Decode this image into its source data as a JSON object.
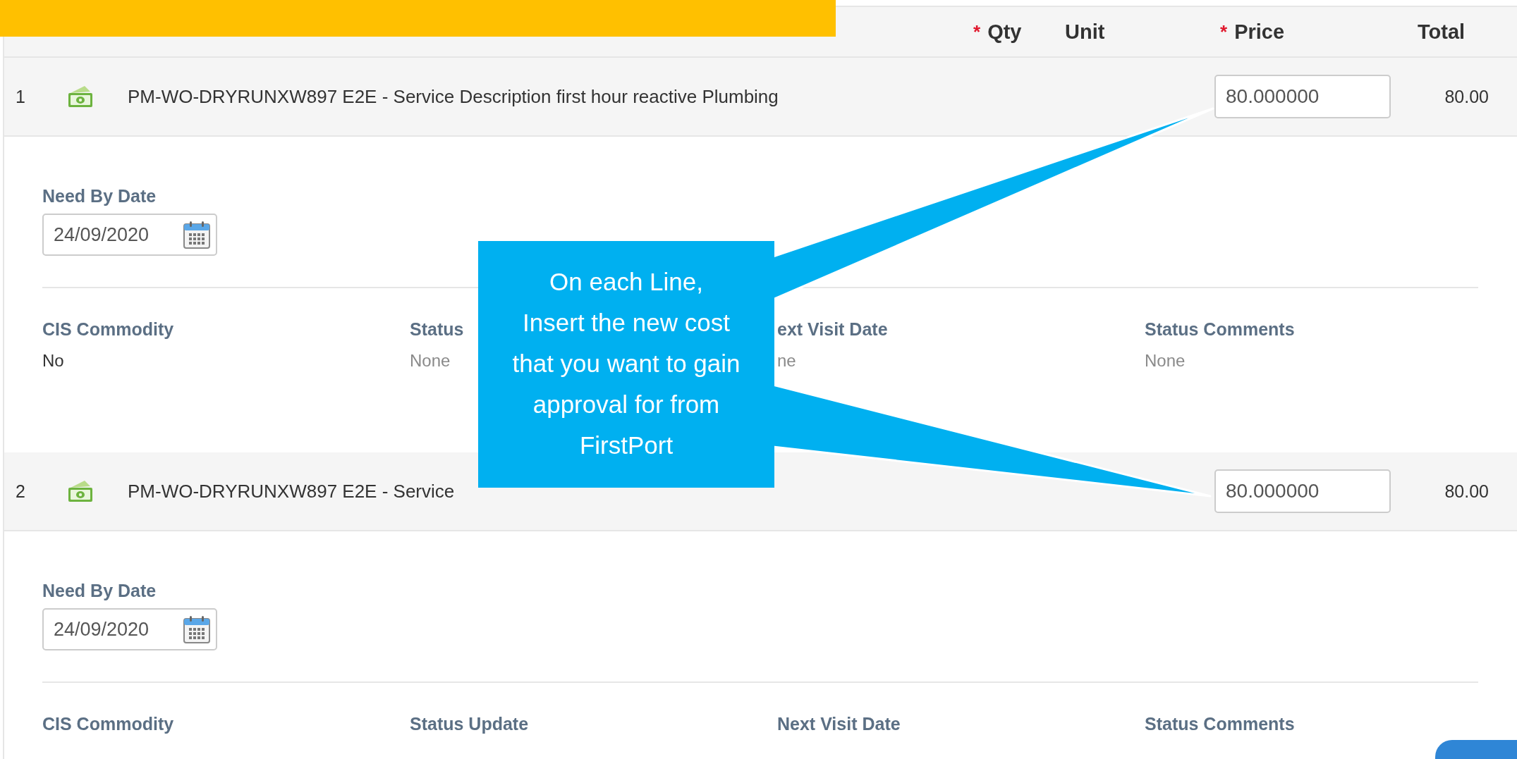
{
  "header": {
    "columns": [
      {
        "label": "Qty",
        "required_mark": "*"
      },
      {
        "label": "Unit"
      },
      {
        "label": "Price",
        "required_mark": "*"
      },
      {
        "label": "Total"
      }
    ]
  },
  "lines": [
    {
      "number": "1",
      "item": "PM-WO-DRYRUNXW897 E2E - Service Description first hour reactive Plumbing",
      "price": "80.000000",
      "total": "80.00",
      "need_by": {
        "label": "Need By Date",
        "value": "24/09/2020"
      },
      "fields": [
        {
          "label": "CIS Commodity",
          "value": "No",
          "muted": false
        },
        {
          "label": "Status",
          "value": "None",
          "muted": true
        },
        {
          "label": "ext Visit Date",
          "value": "ne",
          "muted": true
        },
        {
          "label": "Status Comments",
          "value": "None",
          "muted": true
        }
      ]
    },
    {
      "number": "2",
      "item": "PM-WO-DRYRUNXW897 E2E - Service",
      "price": "80.000000",
      "total": "80.00",
      "need_by": {
        "label": "Need By Date",
        "value": "24/09/2020"
      },
      "fields": [
        {
          "label": "CIS Commodity"
        },
        {
          "label": "Status Update"
        },
        {
          "label": "Next Visit Date"
        },
        {
          "label": "Status Comments"
        }
      ]
    }
  ],
  "callout": {
    "text": "On each Line,\nInsert the new cost\nthat you want to gain\napproval for from\nFirstPort"
  }
}
